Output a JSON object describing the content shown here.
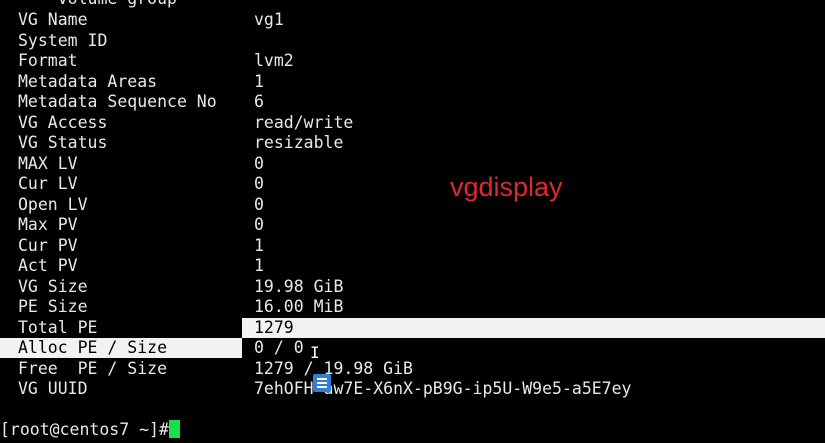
{
  "header_partial": "--- Volume group ---",
  "rows": [
    {
      "key": "VG Name",
      "value": "vg1"
    },
    {
      "key": "System ID",
      "value": ""
    },
    {
      "key": "Format",
      "value": "lvm2"
    },
    {
      "key": "Metadata Areas",
      "value": "1"
    },
    {
      "key": "Metadata Sequence No",
      "value": "6"
    },
    {
      "key": "VG Access",
      "value": "read/write"
    },
    {
      "key": "VG Status",
      "value": "resizable"
    },
    {
      "key": "MAX LV",
      "value": "0"
    },
    {
      "key": "Cur LV",
      "value": "0"
    },
    {
      "key": "Open LV",
      "value": "0"
    },
    {
      "key": "Max PV",
      "value": "0"
    },
    {
      "key": "Cur PV",
      "value": "1"
    },
    {
      "key": "Act PV",
      "value": "1"
    },
    {
      "key": "VG Size",
      "value": "19.98 GiB"
    },
    {
      "key": "PE Size",
      "value": "16.00 MiB"
    },
    {
      "key": "Total PE",
      "value": "1279"
    },
    {
      "key": "Alloc PE / Size",
      "value": "0 / 0"
    },
    {
      "key": "Free  PE / Size",
      "value": "1279 / 19.98 GiB"
    },
    {
      "key": "VG UUID",
      "value": "7ehOFH-aw7E-X6nX-pB9G-ip5U-W9e5-a5E7ey"
    }
  ],
  "highlight": {
    "key_rows": [
      "Alloc PE / Size"
    ],
    "value_rows": [
      "Total PE"
    ]
  },
  "prompt": "[root@centos7 ~]#",
  "annotation": "vgdisplay",
  "colors": {
    "background": "#000000",
    "text": "#e8e8e8",
    "cursor": "#17e04f",
    "annotation": "#e0282e",
    "selection": "#f2f2f2"
  },
  "icons": {
    "cursor_pointer": "i-beam-icon",
    "floating_button": "note-icon"
  }
}
